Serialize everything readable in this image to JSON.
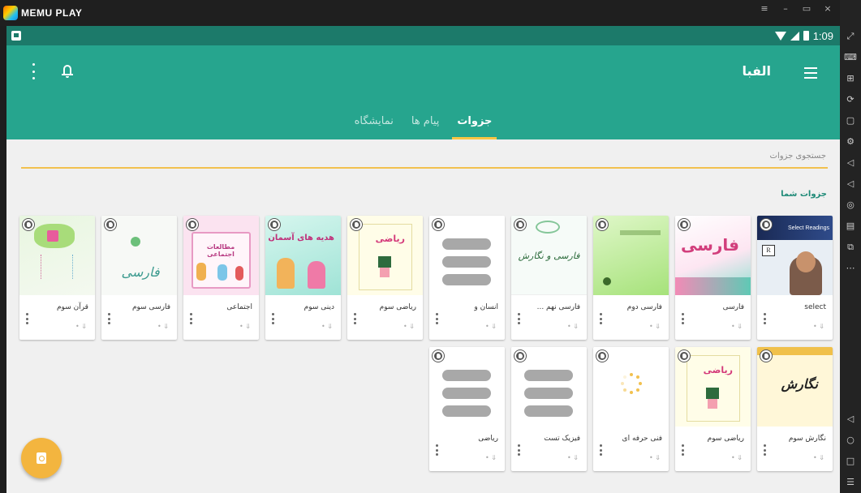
{
  "emulator": {
    "title": "MEMU PLAY",
    "controls": [
      "≡",
      "–",
      "▭",
      "×",
      "«"
    ]
  },
  "status_bar": {
    "time": "1:09"
  },
  "app_bar": {
    "title": "الفبا",
    "tabs": [
      {
        "label": "جزوات",
        "active": true
      },
      {
        "label": "پیام ها",
        "active": false
      },
      {
        "label": "نمایشگاه",
        "active": false
      }
    ]
  },
  "search": {
    "placeholder": "جستجوی جزوات"
  },
  "section": {
    "title": "جزوات شما"
  },
  "cards_row1": [
    {
      "title": "select",
      "cover": "select-readings"
    },
    {
      "title": "فارسی",
      "cover": "farsi-pink"
    },
    {
      "title": "فارسی دوم",
      "cover": "green"
    },
    {
      "title": "فارسی نهم ...",
      "cover": "farsi-negaresh"
    },
    {
      "title": "انسان و",
      "cover": "placeholder"
    },
    {
      "title": "ریاضی سوم",
      "cover": "riazi"
    },
    {
      "title": "دینی سوم",
      "cover": "dini"
    },
    {
      "title": "اجتماعی",
      "cover": "ejtemai"
    },
    {
      "title": "فارسی سوم",
      "cover": "farsi-white"
    },
    {
      "title": "قرآن سوم",
      "cover": "quran"
    }
  ],
  "cards_row2": [
    {
      "title": "نگارش سوم",
      "cover": "negaresh"
    },
    {
      "title": "ریاضی سوم",
      "cover": "riazi"
    },
    {
      "title": "فنی حرفه ای",
      "cover": "loading"
    },
    {
      "title": "فیزیک تست",
      "cover": "placeholder"
    },
    {
      "title": "ریاضی",
      "cover": "placeholder"
    }
  ],
  "card_meta": "• ⇓",
  "cover_texts": {
    "select_readings": "Select Readings",
    "farsi": "فارسی",
    "farsi_negaresh": "فارسی و نگارش",
    "riazi": "ریاضی",
    "dini": "هدیه های آسمان",
    "ejtemai": "مطالعات اجتماعی",
    "negaresh": "نگارش"
  },
  "colors": {
    "primary": "#26a58e",
    "status_bar": "#1c7a6a",
    "accent": "#f3b53f",
    "section_title": "#1e8a77"
  }
}
